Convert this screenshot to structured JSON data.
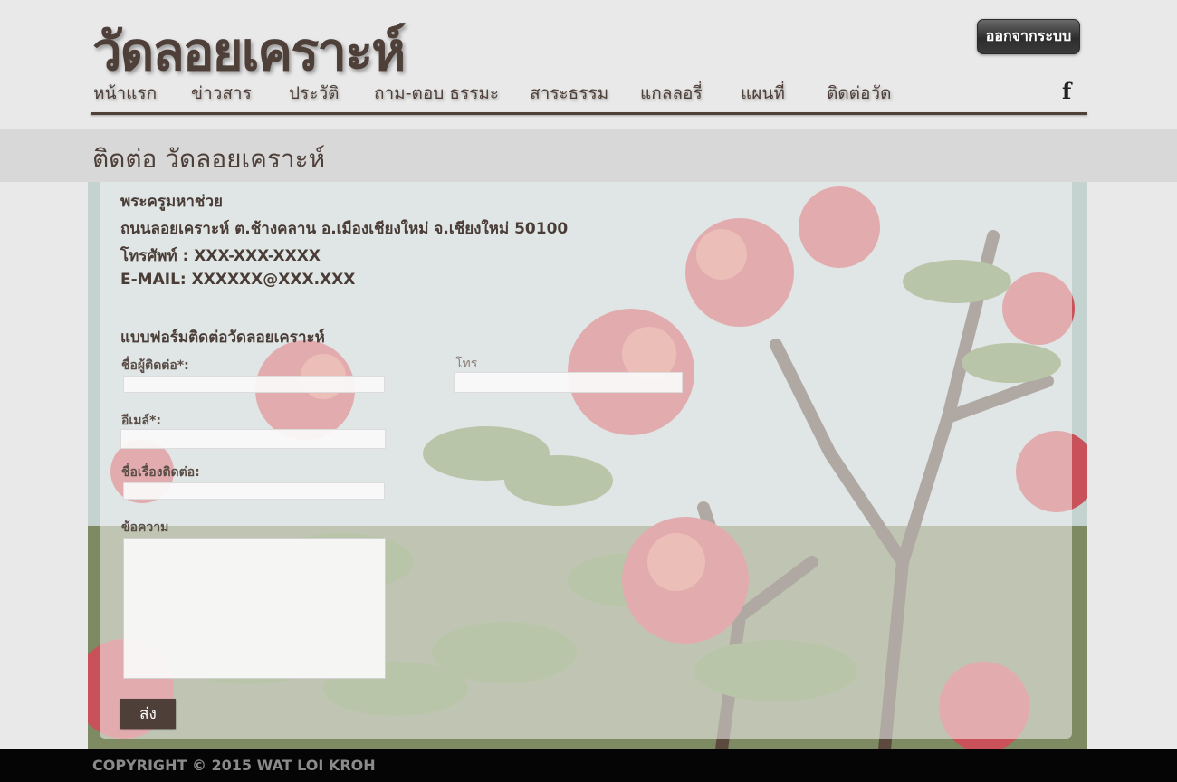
{
  "header": {
    "site_title": "วัดลอยเคราะห์",
    "logout_label": "ออกจากระบบ"
  },
  "nav": {
    "items": [
      {
        "label": "หน้าแรก"
      },
      {
        "label": "ข่าวสาร"
      },
      {
        "label": "ประวัติ"
      },
      {
        "label": "ถาม-ตอบ ธรรมะ"
      },
      {
        "label": "สาระธรรม"
      },
      {
        "label": "แกลลอรี่"
      },
      {
        "label": "แผนที่"
      },
      {
        "label": "ติดต่อวัด"
      }
    ],
    "social_icon": "facebook-icon",
    "social_glyph": "f"
  },
  "page": {
    "title": "ติดต่อ วัดลอยเคราะห์"
  },
  "contact_info": {
    "name": "พระครูมหาช่วย",
    "address": "ถนนลอยเคราะห์ ต.ช้างคลาน อ.เมืองเชียงใหม่ จ.เชียงใหม่ 50100",
    "phone": "โทรศัพท์ : XXX-XXX-XXXX",
    "email": "E-MAIL: XXXXXX@XXX.XXX"
  },
  "form": {
    "heading": "แบบฟอร์มติดต่อวัดลอยเคราะห์",
    "name_label": "ชื่อผู้ติดต่อ*:",
    "phone_label": "โทร",
    "email_label": "อีเมล์*:",
    "subject_label": "ชื่อเรื่องติดต่อ:",
    "message_label": "ข้อความ",
    "name_value": "",
    "phone_value": "",
    "email_value": "",
    "subject_value": "",
    "message_value": "",
    "submit_label": "ส่ง"
  },
  "footer": {
    "copyright": "COPYRIGHT © 2015 WAT LOI KROH"
  },
  "colors": {
    "brand_brown": "#4e3f39",
    "page_background": "#e9e9e9",
    "footer_background": "#050505"
  }
}
